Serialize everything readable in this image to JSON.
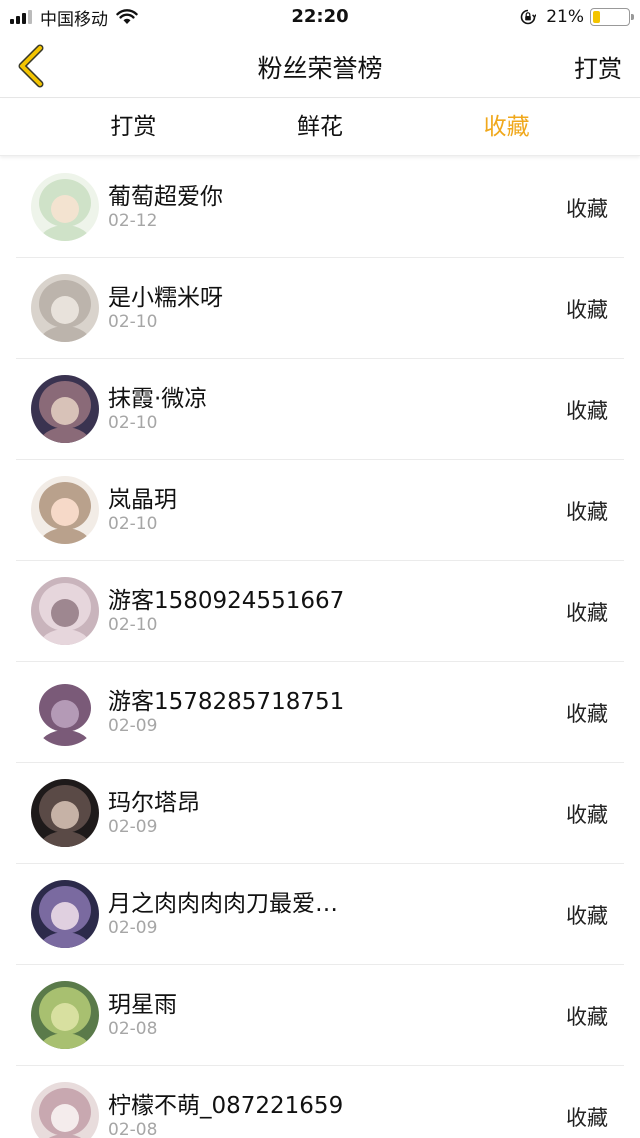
{
  "status_bar": {
    "carrier": "中国移动",
    "time": "22:20",
    "battery": "21%",
    "battery_level": 0.21,
    "icons": [
      "signal-icon",
      "wifi-icon",
      "rotation-lock-icon",
      "battery-icon"
    ]
  },
  "nav": {
    "title": "粉丝荣誉榜",
    "action": "打赏",
    "back_icon": "chevron-left-icon"
  },
  "colors": {
    "accent": "#f0a81c",
    "text": "#111111",
    "subtext": "#a6a6a6",
    "divider": "#ebebeb"
  },
  "tabs": [
    {
      "label": "打赏",
      "active": false
    },
    {
      "label": "鲜花",
      "active": false
    },
    {
      "label": "收藏",
      "active": true
    }
  ],
  "fans": [
    {
      "name": "葡萄超爱你",
      "date": "02-12",
      "action": "收藏",
      "avatar_colors": [
        "#eef4ea",
        "#cfe2c8",
        "#f3e3d0"
      ]
    },
    {
      "name": "是小糯米呀",
      "date": "02-10",
      "action": "收藏",
      "avatar_colors": [
        "#d9d3cc",
        "#bcb4ac",
        "#e8e2db"
      ]
    },
    {
      "name": "抹霞·微凉",
      "date": "02-10",
      "action": "收藏",
      "avatar_colors": [
        "#3a3350",
        "#8a6a78",
        "#d8c2b8"
      ]
    },
    {
      "name": "岚晶玥",
      "date": "02-10",
      "action": "收藏",
      "avatar_colors": [
        "#f2ece6",
        "#b9a18c",
        "#f6d9c8"
      ]
    },
    {
      "name": "游客1580924551667",
      "date": "02-10",
      "action": "收藏",
      "avatar_colors": [
        "#c9b4bc",
        "#e6d6dc",
        "#9e8790"
      ]
    },
    {
      "name": "游客1578285718751",
      "date": "02-09",
      "action": "收藏",
      "avatar_colors": [
        "#ffffff",
        "#7a5a78",
        "#b49ab6"
      ]
    },
    {
      "name": "玛尔塔昂",
      "date": "02-09",
      "action": "收藏",
      "avatar_colors": [
        "#1e1a1a",
        "#5a4a46",
        "#c6b2a6"
      ]
    },
    {
      "name": "月之肉肉肉肉刀最爱…",
      "date": "02-09",
      "action": "收藏",
      "avatar_colors": [
        "#2c2a4a",
        "#7a6aa0",
        "#e0d0e0"
      ]
    },
    {
      "name": "玥星雨",
      "date": "02-08",
      "action": "收藏",
      "avatar_colors": [
        "#5a7a4a",
        "#a8c070",
        "#d8e0a0"
      ]
    },
    {
      "name": "柠檬不萌_087221659",
      "date": "02-08",
      "action": "收藏",
      "avatar_colors": [
        "#e8dcdc",
        "#c8a8b0",
        "#f4ecec"
      ]
    }
  ]
}
